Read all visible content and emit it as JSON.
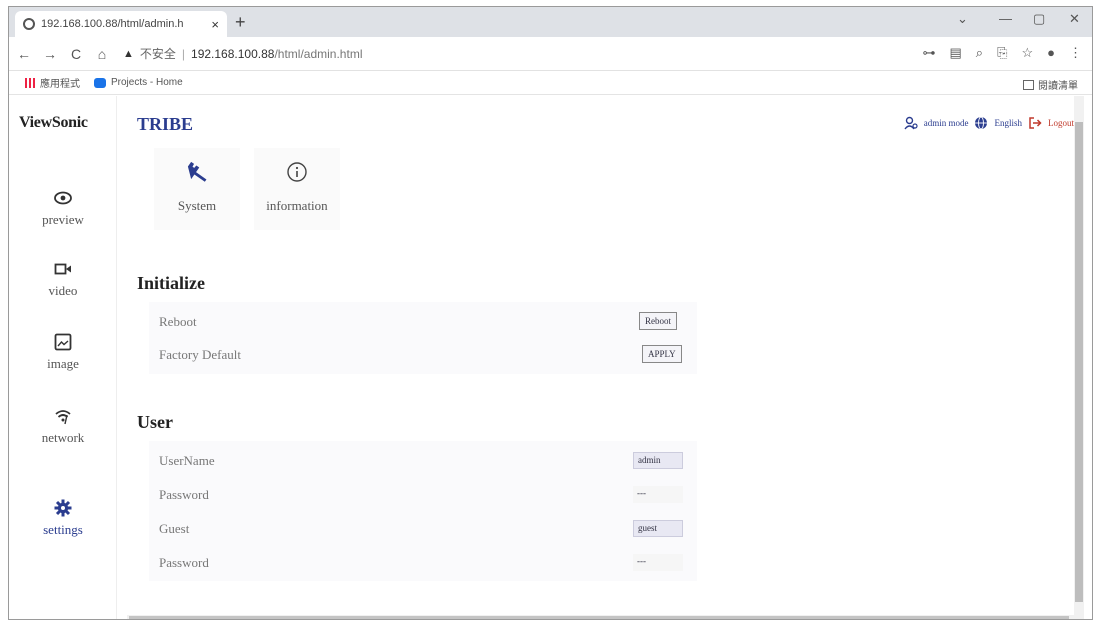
{
  "browser": {
    "tab_title": "192.168.100.88/html/admin.h",
    "tab_close": "×",
    "new_tab": "+",
    "window": {
      "chevron": "⌄",
      "minimize": "—",
      "restore": "▢",
      "close": "✕"
    },
    "nav": {
      "back": "←",
      "forward": "→",
      "reload": "C",
      "home": "⌂"
    },
    "url": {
      "warning": "▲",
      "insecure": "不安全",
      "separator": "|",
      "host": "192.168.100.88",
      "path": "/html/admin.html"
    },
    "toolbar_icons": {
      "key": "⊶",
      "translate": "▤",
      "zoom": "⌕",
      "share": "⎘",
      "star": "☆",
      "profile": "●",
      "menu": "⋮"
    },
    "bookmarks": {
      "apps_label": "應用程式",
      "items": [
        "Projects - Home"
      ],
      "reading_list": "閱讀清單"
    }
  },
  "app": {
    "logo": "ViewSonic",
    "brand": "TRIBE",
    "user": {
      "mode": "admin mode",
      "language": "English",
      "logout": "Logout"
    },
    "sidebar": [
      {
        "label": "preview",
        "icon": "eye-icon"
      },
      {
        "label": "video",
        "icon": "camera-icon"
      },
      {
        "label": "image",
        "icon": "image-icon"
      },
      {
        "label": "network",
        "icon": "wifi-icon"
      },
      {
        "label": "settings",
        "icon": "gear-icon",
        "active": true
      }
    ],
    "cards": [
      {
        "label": "System",
        "icon": "wrench-icon"
      },
      {
        "label": "information",
        "icon": "info-icon"
      }
    ],
    "initialize": {
      "title": "Initialize",
      "reboot_label": "Reboot",
      "reboot_button": "Reboot",
      "factory_label": "Factory Default",
      "factory_button": "APPLY"
    },
    "user_section": {
      "title": "User",
      "username_label": "UserName",
      "username_value": "admin",
      "password_label": "Password",
      "password_value": "---",
      "guest_label": "Guest",
      "guest_value": "guest",
      "guest_password_label": "Password",
      "guest_password_value": "---"
    },
    "colors": {
      "accent": "#2b3d8f",
      "logout": "#c0392b"
    }
  }
}
